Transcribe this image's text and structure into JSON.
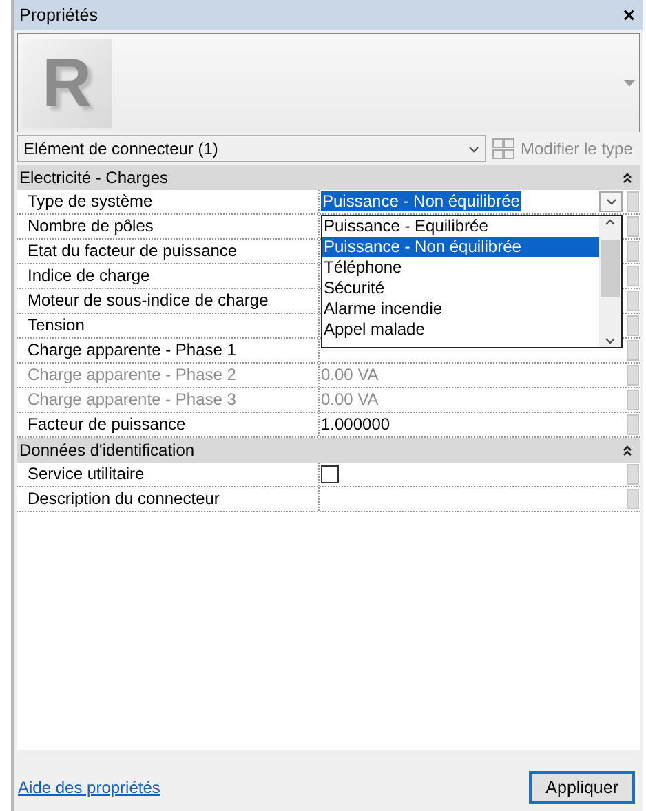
{
  "panel": {
    "title": "Propriétés",
    "close": "×"
  },
  "thumbnail": {
    "letter": "R"
  },
  "type_selector": {
    "value": "Elément de connecteur (1)",
    "edit_type": {
      "label": "Modifier le type",
      "disabled": true
    }
  },
  "groups": [
    {
      "title": "Electricité - Charges",
      "expanded": true,
      "rows": [
        {
          "label": "Type de système",
          "value": "Puissance - Non équilibrée",
          "kind": "dropdown",
          "disabled": false
        },
        {
          "label": "Nombre de pôles",
          "kind": "text",
          "disabled": false
        },
        {
          "label": "Etat du facteur de puissance",
          "kind": "text",
          "disabled": false
        },
        {
          "label": "Indice de charge",
          "kind": "text",
          "disabled": false
        },
        {
          "label": "Moteur de sous-indice de charge",
          "kind": "text",
          "disabled": false
        },
        {
          "label": "Tension",
          "kind": "text",
          "disabled": false
        },
        {
          "label": "Charge apparente - Phase 1",
          "kind": "text",
          "disabled": false
        },
        {
          "label": "Charge apparente - Phase 2",
          "value": "0.00 VA",
          "kind": "text",
          "disabled": true
        },
        {
          "label": "Charge apparente - Phase 3",
          "value": "0.00 VA",
          "kind": "text",
          "disabled": true
        },
        {
          "label": "Facteur de puissance",
          "value": "1.000000",
          "kind": "text",
          "disabled": false
        }
      ]
    },
    {
      "title": "Données d'identification",
      "expanded": true,
      "rows": [
        {
          "label": "Service utilitaire",
          "kind": "checkbox",
          "checked": false,
          "disabled": false
        },
        {
          "label": "Description du connecteur",
          "kind": "text",
          "disabled": false
        }
      ]
    }
  ],
  "dropdown_list": {
    "items": [
      {
        "label": "Puissance - Equilibrée",
        "selected": false
      },
      {
        "label": "Puissance - Non équilibrée",
        "selected": true
      },
      {
        "label": "Téléphone",
        "selected": false
      },
      {
        "label": "Sécurité",
        "selected": false
      },
      {
        "label": "Alarme incendie",
        "selected": false
      },
      {
        "label": "Appel malade",
        "selected": false
      }
    ]
  },
  "footer": {
    "help_link": "Aide des propriétés",
    "apply": "Appliquer"
  }
}
